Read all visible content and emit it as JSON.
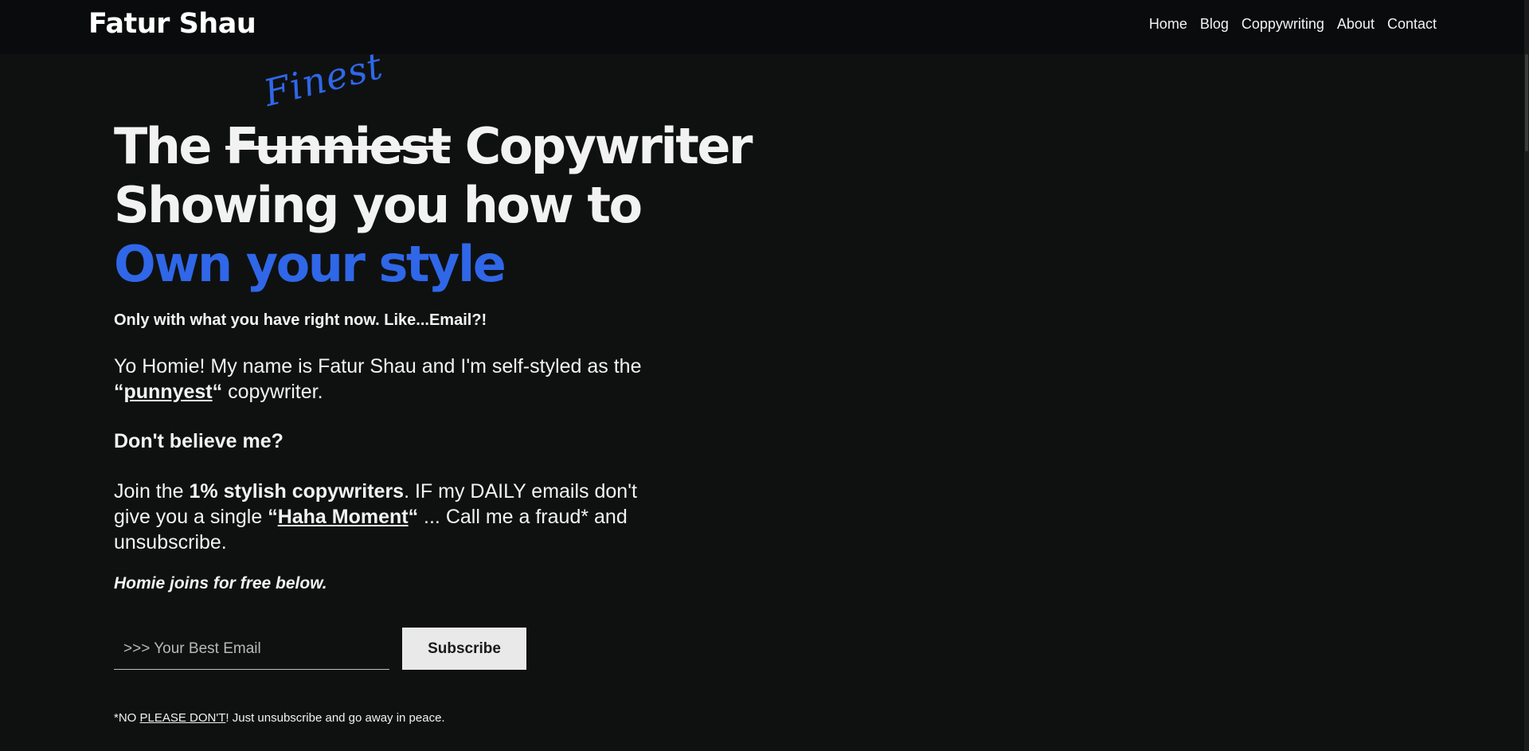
{
  "header": {
    "logo": "Fatur Shau",
    "nav": [
      "Home",
      "Blog",
      "Coppywriting",
      "About",
      "Contact"
    ]
  },
  "hero": {
    "finest": "Finest",
    "line1_the": "The",
    "line1_struck": "Funniest",
    "line1_rest": "Copywriter",
    "line2": "Showing you how to",
    "line3": "Own your style",
    "subheading": "Only with what you have right now. Like...Email?!",
    "intro_a": "Yo Homie! My name is Fatur Shau and I'm self-styled as the ",
    "intro_quote_open": "“",
    "intro_punny": "punnyest",
    "intro_quote_close": "“",
    "intro_b": " copywriter.",
    "dont_believe": "Don't believe me?",
    "join_a": "Join the ",
    "join_bold": "1% stylish copywriters",
    "join_b": ". IF my DAILY emails don't give you a single ",
    "join_quote_open": "“",
    "join_haha": "Haha Moment",
    "join_quote_close": "“",
    "join_c": " ... Call me a fraud* and unsubscribe.",
    "homie_joins": "Homie joins for free below."
  },
  "form": {
    "email_placeholder": ">>> Your Best Email",
    "subscribe_label": "Subscribe"
  },
  "footnote": {
    "a": "*NO ",
    "underlined": "PLEASE DON'T",
    "b": "! Just unsubscribe and go away in peace."
  },
  "colors": {
    "background": "#0f1111",
    "header": "#0a0b0c",
    "accent": "#2f67e8",
    "button": "#e9e9ea"
  }
}
